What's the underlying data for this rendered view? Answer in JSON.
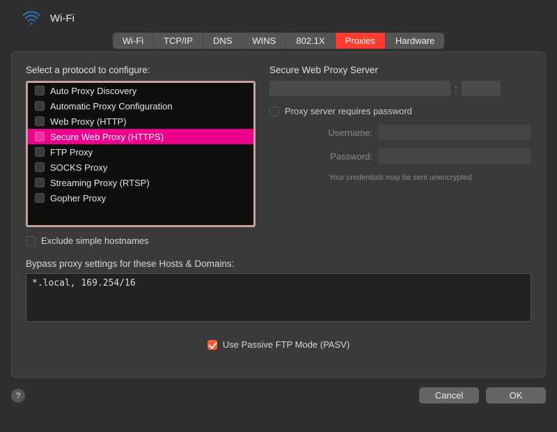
{
  "header": {
    "title": "Wi-Fi"
  },
  "tabs": [
    {
      "label": "Wi-Fi",
      "active": false
    },
    {
      "label": "TCP/IP",
      "active": false
    },
    {
      "label": "DNS",
      "active": false
    },
    {
      "label": "WINS",
      "active": false
    },
    {
      "label": "802.1X",
      "active": false
    },
    {
      "label": "Proxies",
      "active": true
    },
    {
      "label": "Hardware",
      "active": false
    }
  ],
  "left": {
    "section_label": "Select a protocol to configure:",
    "items": [
      {
        "label": "Auto Proxy Discovery",
        "checked": false,
        "selected": false
      },
      {
        "label": "Automatic Proxy Configuration",
        "checked": false,
        "selected": false
      },
      {
        "label": "Web Proxy (HTTP)",
        "checked": false,
        "selected": false
      },
      {
        "label": "Secure Web Proxy (HTTPS)",
        "checked": false,
        "selected": true
      },
      {
        "label": "FTP Proxy",
        "checked": false,
        "selected": false
      },
      {
        "label": "SOCKS Proxy",
        "checked": false,
        "selected": false
      },
      {
        "label": "Streaming Proxy (RTSP)",
        "checked": false,
        "selected": false
      },
      {
        "label": "Gopher Proxy",
        "checked": false,
        "selected": false
      }
    ],
    "exclude_simple_label": "Exclude simple hostnames",
    "exclude_simple_checked": false
  },
  "right": {
    "server_label": "Secure Web Proxy Server",
    "server_host": "",
    "server_port": "",
    "requires_password_label": "Proxy server requires password",
    "requires_password_checked": false,
    "username_label": "Username:",
    "username_value": "",
    "password_label": "Password:",
    "password_value": "",
    "cred_note": "Your credentials may be sent unencrypted"
  },
  "bypass": {
    "label": "Bypass proxy settings for these Hosts & Domains:",
    "value": "*.local, 169.254/16"
  },
  "pasv": {
    "label": "Use Passive FTP Mode (PASV)",
    "checked": true
  },
  "footer": {
    "cancel": "Cancel",
    "ok": "OK"
  },
  "icons": {
    "wifi": "wifi-icon",
    "help": "?"
  }
}
